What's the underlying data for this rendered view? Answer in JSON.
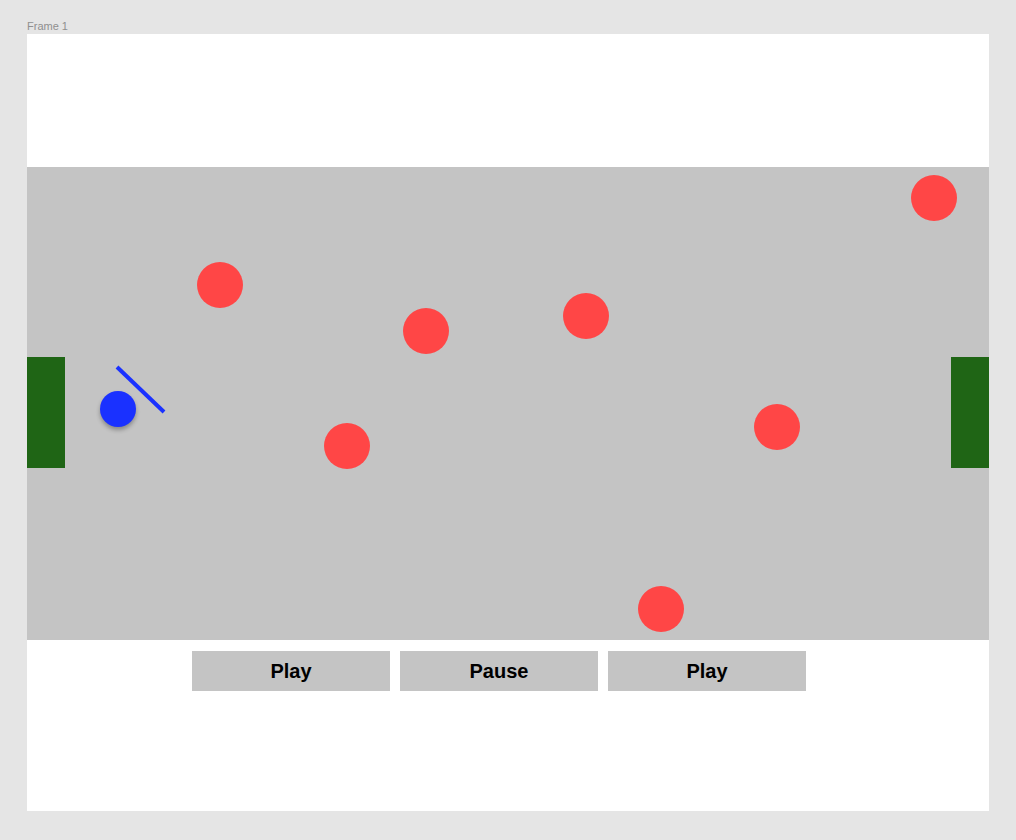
{
  "frame": {
    "title": "Frame 1"
  },
  "players": [
    {
      "team": "home",
      "color": "#1a31ff",
      "has_stick": true
    },
    {
      "team": "away",
      "color": "#ff4646",
      "has_stick": false
    },
    {
      "team": "away",
      "color": "#ff4646",
      "has_stick": false
    },
    {
      "team": "away",
      "color": "#ff4646",
      "has_stick": false
    },
    {
      "team": "away",
      "color": "#ff4646",
      "has_stick": false
    },
    {
      "team": "away",
      "color": "#ff4646",
      "has_stick": false
    },
    {
      "team": "away",
      "color": "#ff4646",
      "has_stick": false
    },
    {
      "team": "away",
      "color": "#ff4646",
      "has_stick": false
    }
  ],
  "buttons": [
    {
      "label": "Play"
    },
    {
      "label": "Pause"
    },
    {
      "label": "Play"
    }
  ]
}
